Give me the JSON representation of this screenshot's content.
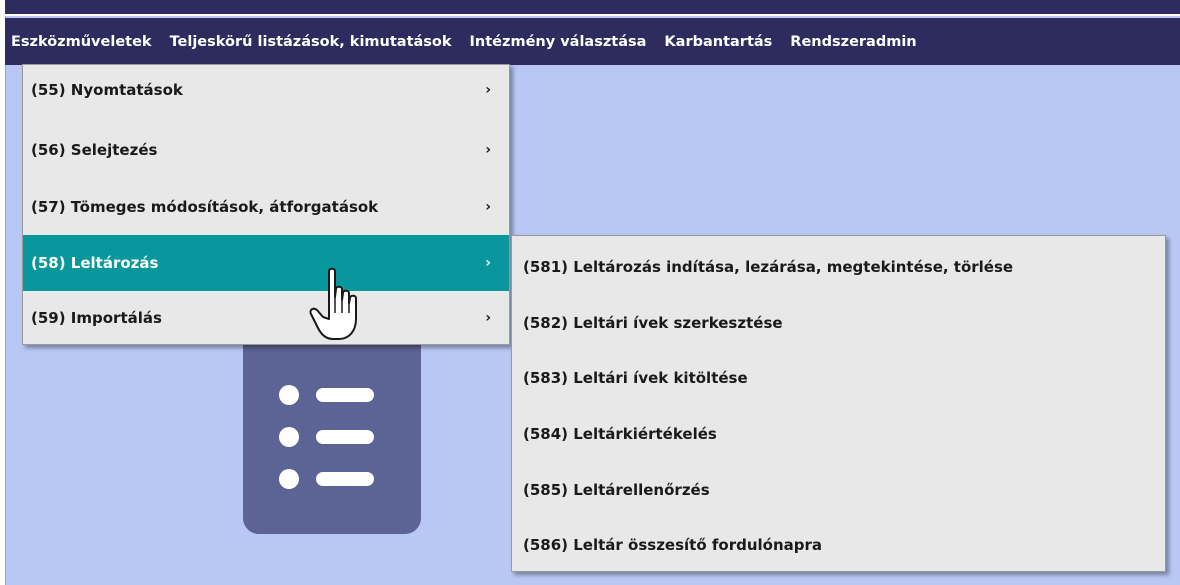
{
  "menubar": {
    "items": [
      {
        "label": "Eszközműveletek"
      },
      {
        "label": "Teljeskörű listázások, kimutatások"
      },
      {
        "label": "Intézmény választása"
      },
      {
        "label": "Karbantartás"
      },
      {
        "label": "Rendszeradmin"
      }
    ]
  },
  "menu": {
    "items": [
      {
        "label": "(55) Nyomtatások",
        "arrow": "›"
      },
      {
        "label": "(56) Selejtezés",
        "arrow": "›"
      },
      {
        "label": "(57) Tömeges módosítások, átforgatások",
        "arrow": "›"
      },
      {
        "label": "(58) Leltározás",
        "arrow": "›",
        "active": true
      },
      {
        "label": "(59) Importálás",
        "arrow": "›"
      }
    ]
  },
  "submenu": {
    "items": [
      {
        "label": "(581) Leltározás indítása, lezárása, megtekintése, törlése"
      },
      {
        "label": "(582) Leltári ívek szerkesztése"
      },
      {
        "label": "(583) Leltári ívek kitöltése"
      },
      {
        "label": "(584) Leltárkiértékelés"
      },
      {
        "label": "(585) Leltárellenőrzés"
      },
      {
        "label": "(586) Leltár összesítő fordulónapra"
      }
    ]
  },
  "colors": {
    "menubar_bg": "#2e2c5e",
    "page_bg": "#b9c7f5",
    "active_item_bg": "#08979c",
    "menu_bg": "#e8e8e8",
    "illustration_bg": "#5c6395"
  },
  "icons": [
    "list-document-icon",
    "hand-pointer-cursor-icon",
    "chevron-right-icon"
  ]
}
